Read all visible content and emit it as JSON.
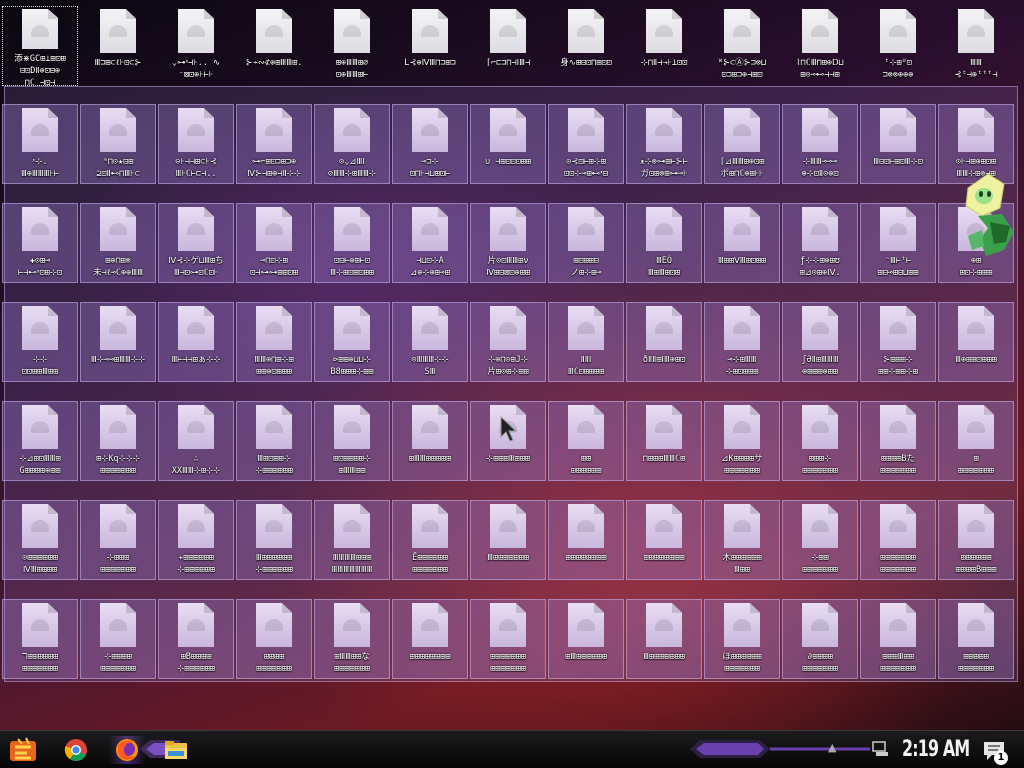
{
  "desktop": {
    "icons": [
      {
        "label": "添⋇GC⊞⊥⊞⊡⊞\n⊟⊡DⅡ⊕⊡⊟⊕\n⊓ℂ ⊣⊡⊣"
      },
      {
        "label": "Ⅲ⊐⊞⊂ℓ⊦⊡⊂⊱"
      },
      {
        "label": "⌄⊶ᵜ⊣⊦.. ∿\n⁻⊠⊡⊕⊦⊢⊦"
      },
      {
        "label": "⊱⌁∾⊄⊕⊞ⅢⅢ⊞."
      },
      {
        "label": "⊞⊕ⅢⅢ⊞⌀\n⊡⊕ⅢⅢ⊞⊢"
      },
      {
        "label": "L⊰⊕ⅣⅢ⊓⊐⊞⊐"
      },
      {
        "label": "⌈⌐⊏⊐⊓⊣ⅠⅢ⊣"
      },
      {
        "label": "身∿⊞⊟⊡⊓⊞⊡⊡"
      },
      {
        "label": "⊹⊓Ⅱ⊣→⊦⊥⊡⊡"
      },
      {
        "label": "ᵂ⊱⊂Ⓐ⊱⊐⊗⊔\n⊡⊐⊞⊐⊕⊣⊞⊡"
      },
      {
        "label": "⌇⊓ℂⅢ⊓⊞⊕Ⅾ⊔\n⊞⊙⊸⊷⊣⊣⊞"
      },
      {
        "label": "ᵗ⊹⊞ᵁ⊡\n⊐⊗⊗⊕⊕⊕"
      },
      {
        "label": "ⅢⅢ\n⊰ᵗ⊣⊕ᵗᵗᵗ⊣"
      },
      {
        "label": "ᵜ⊹.\nⅢ⊕ⅢⅢⅢ⊦⊢"
      },
      {
        "label": "ᵐ⊓⊙★⊟⊞\n⊇⊡Ⅱ⊷⊓Ⅲ⊦⊂"
      },
      {
        "label": "⊖⊦⊣⊣⊞⊂⊦⊰\nⅢ⊦ℂ⊢⊏⊣.."
      },
      {
        "label": "⊶⌐⊞⊡⊐⊞⊐⊕\nⅣ⊱⊣⊞⊕⊣Ⅱ⊹⊹"
      },
      {
        "label": "⊙⌄⊿ⅢⅠ\n⊘ⅢⅢ⊹⊞ⅢⅢ⊹"
      },
      {
        "label": "⊸⊐⊹\n⊡⊓⊦⊣⊔⊞⊡⊢"
      },
      {
        "label": "∪ ⊣⊞⊡⊡⊡⊞⊞"
      },
      {
        "label": "⊙⊰⊡⊢⊞⊹⊞\n⊡⊡⊹⊸⊞⊷ᵜ⊟"
      },
      {
        "label": "ᴥ⊹⊗⊶⊞⊢⊱⊢\nガ⊡⊞⊗⊞⊶⊸⊦"
      },
      {
        "label": "⌈⊿ⅢⅢ⊞⊕⊡⊞\nポ⊞⊓ℂ⊕⊞⊦⊦"
      },
      {
        "label": "⊹ⅢⅢ⊸⊸⊸\n⊕⊹⊡Ⅱ⊙⊕⊡"
      },
      {
        "label": "Ⅲ⊟⊡⊢⊞⊡Ⅲ⊹⊡"
      },
      {
        "label": "⊙⊦⊣⊞⊕⊞⊡⊞\nⅢⅢ⊹⊞⊗⊣⊞"
      },
      {
        "label": "✚⊙⊞⊸\n⊢⊣⊷ᵜ⊡⊞⊹⊡"
      },
      {
        "label": "⊞⊕⊓⊞⊗\n未⊣ℓ⊸ℂ⊕⊕ⅢⅢ"
      },
      {
        "label": "Ⅳ⊰⊹ゲ⊔Ⅲ⊞ち\nⅢ⊣⊡⊶⊡ℂ⊡⊦"
      },
      {
        "label": "⊸⊓⊡⊹⊞\n⊡⊣⊶⊶⊞⊞⊡⊞"
      },
      {
        "label": "⊡⊟⊢⊕⊞⊢⊡\nⅢ⊹⊞⊡⊞⊡⊞⊞"
      },
      {
        "label": "⊣⊔⊡⊹A\n⊿⊕⊹⊕⊞⊸⊞"
      },
      {
        "label": "片⊙⊡ⅢⅢ⊞ν\nⅣ⊞⊟⊠⊡⊕⊞⊞"
      },
      {
        "label": "⊞⊡⊞⊞⊟\nノ⊞⊹⊞⊸"
      },
      {
        "label": "ⅢEŐ\nⅢ⊞Ⅲ⊞⊡⊞"
      },
      {
        "label": "Ⅲ⊞⊞ⅤⅢ⊞⊡⊞⊞"
      },
      {
        "label": "ƒ⊹⊹⊞⊕⊞ʊ\n⊞⊿⊙⊞⊕ⅠⅤ."
      },
      {
        "label": "ᵔⅢ⊢ᵗ⊢\n⊞⊟⊸⊞⊟⊔⊞⊞"
      },
      {
        "label": "⊕⊞\n⊞⊡⊹⊞⊞⊞"
      },
      {
        "label": "⊹⊹\n⊡⊡⊞⊞Ⅲ⊞⊞"
      },
      {
        "label": "Ⅲ⊹⊸⊸⊞ⅢⅢ⊹⊹"
      },
      {
        "label": "Ⅲ⊢⊣⊣⊞ぁ⊹⊹"
      },
      {
        "label": "ⅢⅢ⊕⊓⊞⊹⊞\n⊞⊞⊕⊡⊞⊞⊞"
      },
      {
        "label": "⊳⊞⊞⊕⊔⊔⊹\nB8⊞⊞⊞⊹⊞⊞"
      },
      {
        "label": "⊙ⅢⅢⅢ⊹⊹\nSⅢ"
      },
      {
        "label": "⊹⊕⊓⊙⊞J⊹\n片⊞⊙⊞⊹⊞⊞"
      },
      {
        "label": "ⅡⅡⅠ\nⅢℂ⊡⊞⊞⊞⊞"
      },
      {
        "label": "ðⅡⅡ⊞ⅠⅢ⊕⊞⊡"
      },
      {
        "label": "⊸⊹⊞ⅢⅢ\n⊹⊞⊡⊞⊞⊞"
      },
      {
        "label": "ʃƏⅡ⊞ⅢⅢⅢ\n⊕⊞⊞⊞⊕⊞⊞"
      },
      {
        "label": "⊱⊞⊞⊞⊹\n⊞⊞⊹⊞⊞⊹⊞"
      },
      {
        "label": "Ⅲ⊕⊞⊞⊡⊞⊞⊞"
      },
      {
        "label": "⊹⊿⊞⊡ⅢⅢ⊞\nG⊞⊞⊞⊞⊕⊞⊞"
      },
      {
        "label": "⊞⊹Kq⊹⊹⊹\n⊞⊞⊞⊞⊞⊞⊞"
      },
      {
        "label": "∴\nXXⅢⅢ⊹⊞⊹⊹"
      },
      {
        "label": "Ⅲ⊞⊡⊞⊞⊹\n⊹⊞⊞⊞⊞⊞⊞"
      },
      {
        "label": "⊞⊡⊞⊞⊞⊞⊹\n⊞ⅢⅢ⊞⊞"
      },
      {
        "label": "⊞ⅢⅢ⊞⊞⊞⊞⊞"
      },
      {
        "label": "⊹⊞⊞⊞Ⅲ⊞⊞⊞"
      },
      {
        "label": "⊞⊞\n⊞⊞⊞⊞⊞⊞"
      },
      {
        "label": "⊓⊞⊞⊞ⅢⅢℂ⊞"
      },
      {
        "label": "⊿K⊞⊞⊞⊞サ\n⊞⊞⊞⊞⊞⊞⊞"
      },
      {
        "label": "⊞⊞⊞⊹\n⊞⊞⊞⊞⊞⊞⊞"
      },
      {
        "label": "⊞⊞⊞⊞Bた\n⊞⊞⊞⊞⊞⊞⊞"
      },
      {
        "label": "⊞\n⊞⊞⊞⊞⊞⊞⊞"
      },
      {
        "label": "⊙⊞⊞⊞⊞⊞⊞\nⅣⅢ⊞⊞⊞⊞"
      },
      {
        "label": "⊹⊞⊞⊞\n⊞⊞⊞⊞⊞⊞⊞"
      },
      {
        "label": "✦⊞⊞⊞⊞⊞⊞\n⊹⊞⊞⊞⊞⊞⊞"
      },
      {
        "label": "Ⅲ⊞⊞⊞⊞⊞⊞\n⊹⊞⊞⊞⊞⊞⊞"
      },
      {
        "label": "ⅢⅢⅢⅢ⊞⊞⊞\nⅢⅢⅢⅢⅢⅢⅢ"
      },
      {
        "label": "Ё⊞⊞⊞⊞⊞⊞\n⊞⊞⊞⊞⊞⊞⊞"
      },
      {
        "label": "Ⅲ⊞⊞⊞⊞⊞⊞⊞"
      },
      {
        "label": "⊞⊞⊞⊞⊞⊞⊞⊞"
      },
      {
        "label": "⊞⊞⊞⊞⊞⊞⊞⊞"
      },
      {
        "label": "木⊞⊞⊞⊞⊞⊞\nⅢ⊞⊞"
      },
      {
        "label": "⊹⊞⊞\n⊞⊞⊞⊞⊞⊞⊞"
      },
      {
        "label": "⊞⊞⊞⊞⊞⊞⊞\n⊞⊞⊞⊞⊞⊞⊞"
      },
      {
        "label": "⊞⊞⊞⊞⊞⊞\n⊞⊞⊞⊞B⊞⊞⊞"
      },
      {
        "label": "ℸ⊞⊞⊞⊞⊞⊞\n⊞⊞⊞⊞⊞⊞⊞"
      },
      {
        "label": "⊹⊞⊞⊞⊞\n⊞⊞⊞⊞⊞⊞⊞"
      },
      {
        "label": "⊞B⊞⊞⊞⊞\n⊹⊞⊞⊞⊞⊞⊞"
      },
      {
        "label": "⊞⊞⊞⊞\n⊞⊞⊞⊞⊞⊞⊞"
      },
      {
        "label": "⊞ⅢⅢ⊞⊞な\n⊞⊞⊞⊞⊞⊞⊞"
      },
      {
        "label": "⊞⊞⊞⊞⊞⊞⊞⊞"
      },
      {
        "label": "⊞⊞⊞⊞⊞⊞⊞\n⊞⊞⊞⊞⊞⊞⊞"
      },
      {
        "label": "⊞Ⅲ⊞⊞⊞⊞⊞⊞"
      },
      {
        "label": "Ⅲ⊞⊞⊞⊞⊞⊞⊞"
      },
      {
        "label": "ほ⊞⊞⊞⊞⊞⊞\n⊞⊞⊞⊞⊞⊞⊞"
      },
      {
        "label": "∂⊞⊞⊞⊞\n⊞⊞⊞⊞⊞⊞⊞"
      },
      {
        "label": "⊞⊞⊞Ⅲ⊞⊞\n⊞⊞⊞⊞⊞⊞⊞"
      },
      {
        "label": "⊞⊞⊞⊞⊞\n⊞⊞⊞⊞⊞⊞⊞"
      }
    ]
  },
  "taskbar": {
    "clock": "2:19 AM",
    "notification_count": "1",
    "apps": [
      "chrome-icon",
      "firefox-icon",
      "file-explorer-icon"
    ]
  },
  "colors": {
    "selection": "#9678c8",
    "taskbar": "#0b0b0c",
    "accent": "#7a4fc1"
  }
}
